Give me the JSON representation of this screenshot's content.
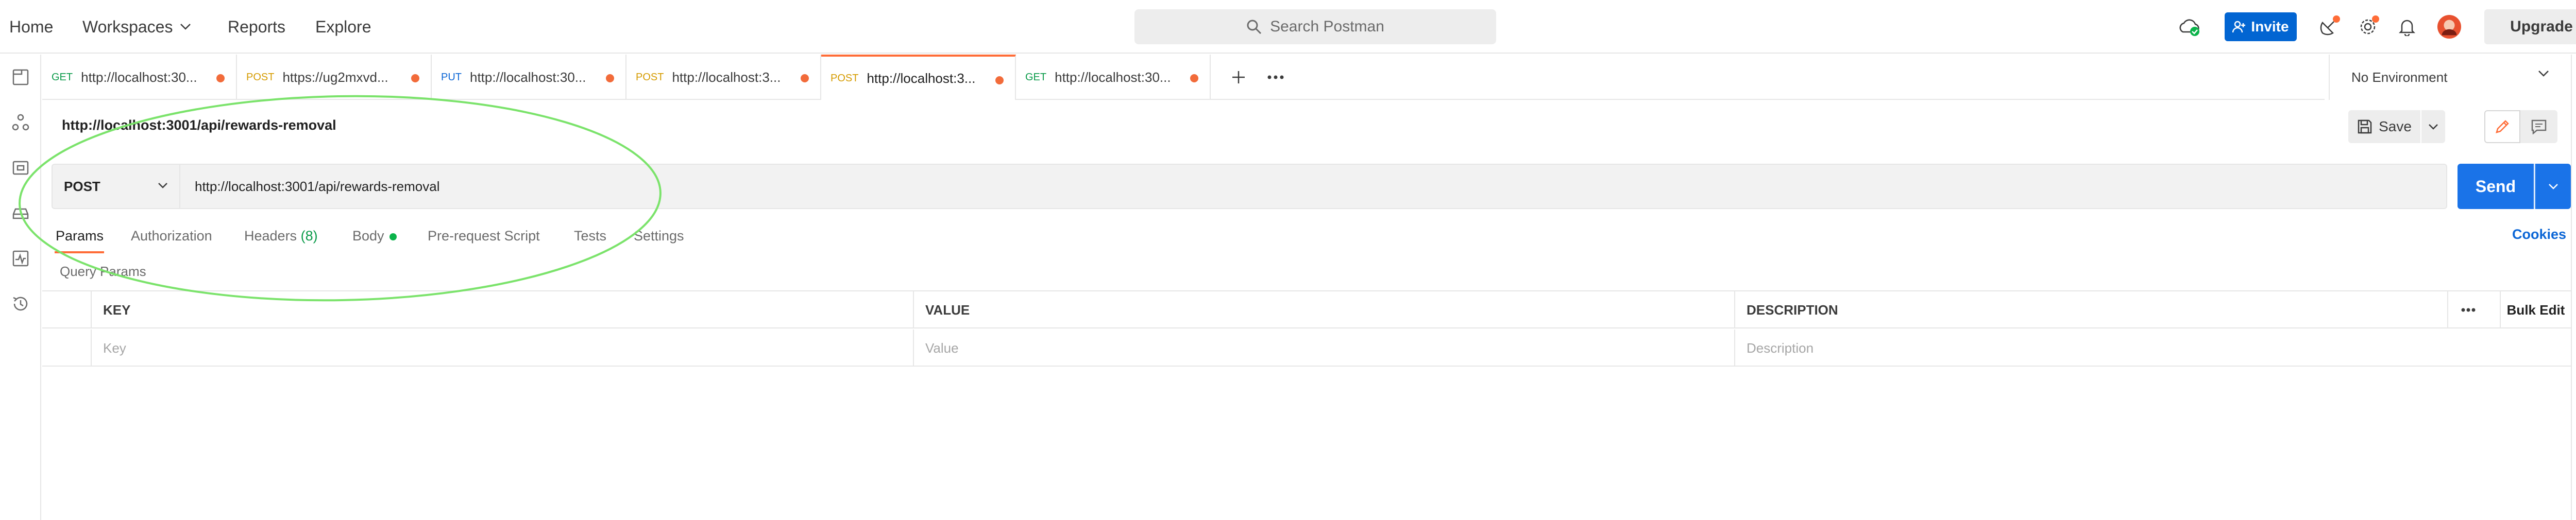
{
  "topnav": {
    "home": "Home",
    "workspaces": "Workspaces",
    "reports": "Reports",
    "explore": "Explore",
    "search_placeholder": "Search Postman",
    "invite": "Invite",
    "upgrade": "Upgrade"
  },
  "tabs": [
    {
      "method": "GET",
      "url": "http://localhost:30...",
      "method_color": "#0b9b4a"
    },
    {
      "method": "POST",
      "url": "https://ug2mxvd...",
      "method_color": "#d59b00"
    },
    {
      "method": "PUT",
      "url": "http://localhost:30...",
      "method_color": "#0b66d6"
    },
    {
      "method": "POST",
      "url": "http://localhost:3...",
      "method_color": "#d59b00"
    },
    {
      "method": "POST",
      "url": "http://localhost:3...",
      "method_color": "#d59b00",
      "active": true
    },
    {
      "method": "GET",
      "url": "http://localhost:30...",
      "method_color": "#0b9b4a"
    }
  ],
  "environment": "No Environment",
  "request": {
    "title": "http://localhost:3001/api/rewards-removal",
    "save": "Save",
    "method": "POST",
    "url": "http://localhost:3001/api/rewards-removal",
    "send": "Send"
  },
  "subtabs": {
    "params": "Params",
    "authorization": "Authorization",
    "headers": "Headers",
    "headers_count": "(8)",
    "body": "Body",
    "prerequest": "Pre-request Script",
    "tests": "Tests",
    "settings": "Settings",
    "cookies": "Cookies"
  },
  "query_params": {
    "label": "Query Params",
    "columns": [
      "KEY",
      "VALUE",
      "DESCRIPTION"
    ],
    "bulk_edit": "Bulk Edit",
    "placeholders": {
      "key": "Key",
      "value": "Value",
      "description": "Description"
    }
  },
  "colors": {
    "accent": "#ff6c37",
    "send_blue": "#1a73e8",
    "invite_blue": "#0265d2",
    "annotation_green": "#7be36b",
    "unsaved_dot": "#f26b3a"
  },
  "icons": {
    "sidebar": [
      "collections-icon",
      "apis-icon",
      "environments-icon",
      "mock-servers-icon",
      "monitors-icon",
      "history-icon"
    ],
    "topbar": [
      "sync-status-icon",
      "satellite-icon",
      "settings-icon",
      "bell-icon",
      "avatar"
    ]
  }
}
